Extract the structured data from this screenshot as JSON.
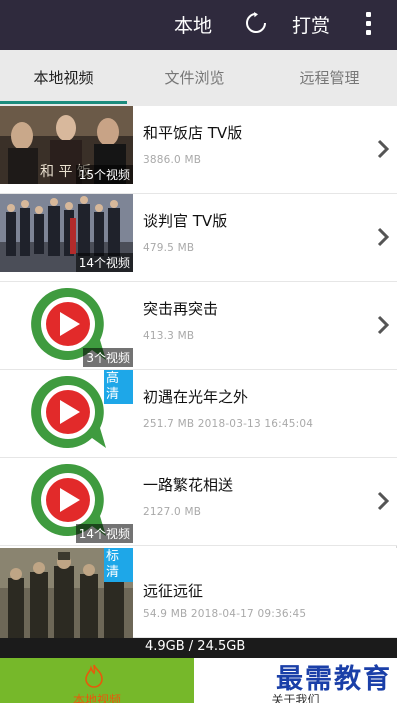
{
  "appbar": {
    "local_label": "本地",
    "reward_label": "打赏",
    "refresh_icon": "refresh-icon",
    "more_icon": "more-vert-icon",
    "bg_color": "#2f2a3d"
  },
  "tabs": [
    {
      "label": "本地视频",
      "active": true
    },
    {
      "label": "文件浏览",
      "active": false
    },
    {
      "label": "远程管理",
      "active": false
    }
  ],
  "videos": [
    {
      "title": "和平饭店 TV版",
      "meta": "3886.0 MB",
      "count": "15个视频",
      "hd": "",
      "has_chevron": true,
      "thumb": "photo-1"
    },
    {
      "title": "谈判官 TV版",
      "meta": "479.5 MB",
      "count": "14个视频",
      "hd": "",
      "has_chevron": true,
      "thumb": "photo-2"
    },
    {
      "title": "突击再突击",
      "meta": "413.3 MB",
      "count": "3个视频",
      "hd": "",
      "has_chevron": true,
      "thumb": "app-icon"
    },
    {
      "title": "初遇在光年之外",
      "meta": "251.7 MB  2018-03-13 16:45:04",
      "count": "",
      "hd": "高清",
      "has_chevron": false,
      "thumb": "app-icon"
    },
    {
      "title": "一路繁花相送",
      "meta": "2127.0 MB",
      "count": "14个视频",
      "hd": "",
      "has_chevron": true,
      "thumb": "app-icon"
    },
    {
      "title": "远征远征",
      "meta": "54.9 MB  2018-04-17 09:36:45",
      "count": "",
      "hd": "标清",
      "has_chevron": false,
      "thumb": "photo-3"
    }
  ],
  "storage": {
    "text": "4.9GB / 24.5GB"
  },
  "bottom_nav": {
    "left_label": "本地视频",
    "right_label": "关于我们",
    "left_color": "#76b82a",
    "left_text_color": "#e8590c"
  },
  "watermark": {
    "text": "最需教育"
  }
}
